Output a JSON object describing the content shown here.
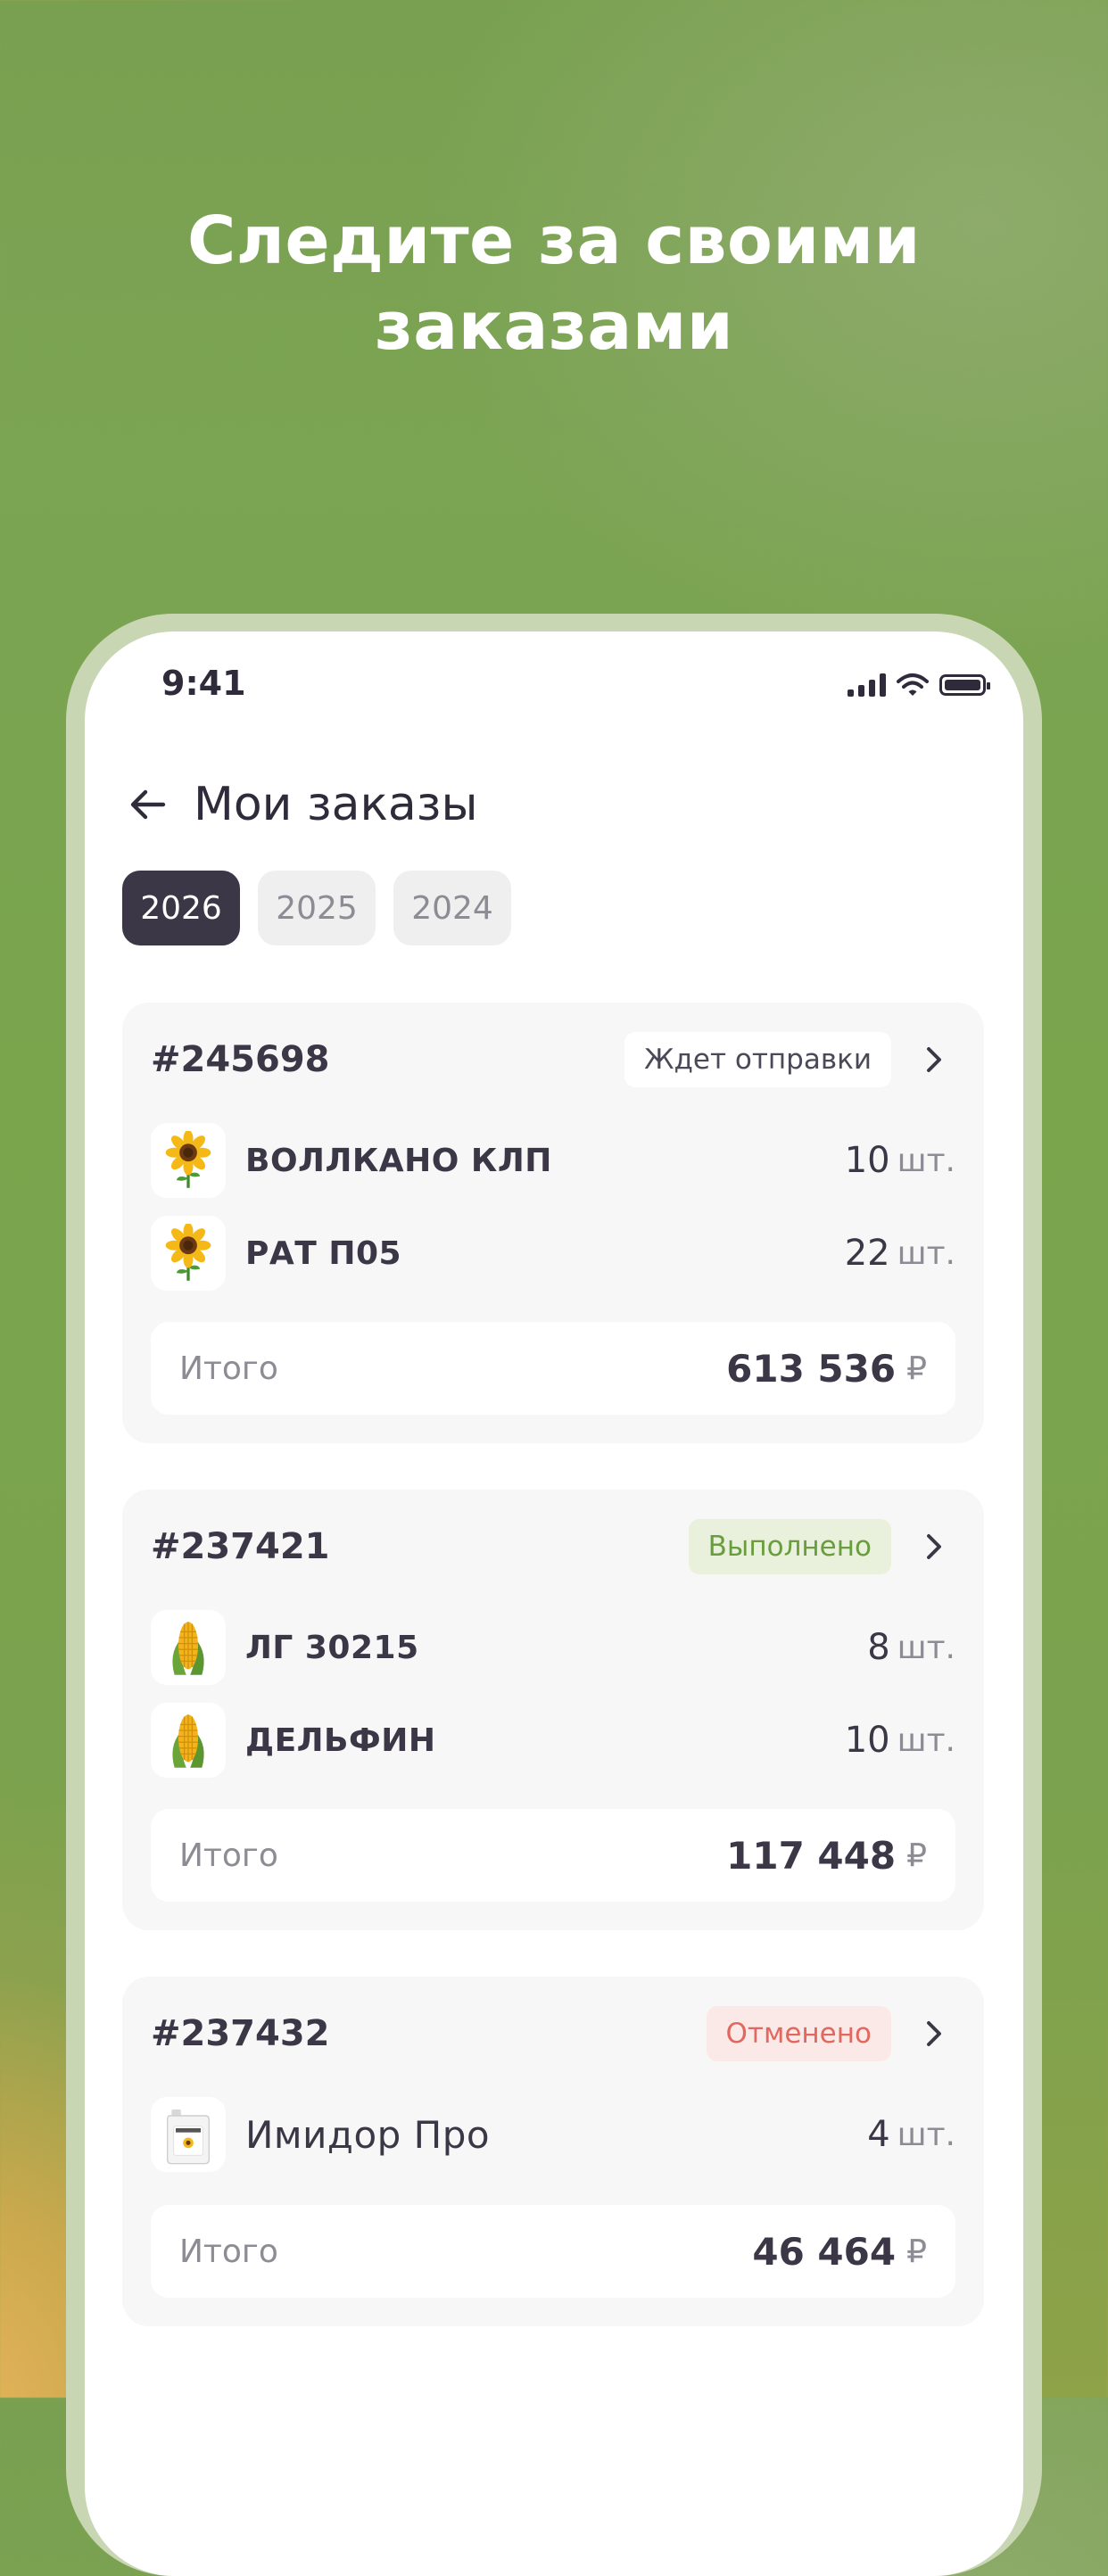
{
  "headline": {
    "line1": "Следите за своими",
    "line2": "заказами"
  },
  "status_bar": {
    "time": "9:41",
    "icons": [
      "signal-icon",
      "wifi-icon",
      "battery-icon"
    ]
  },
  "header": {
    "back_icon": "arrow-left-icon",
    "title": "Мои заказы"
  },
  "years": [
    {
      "label": "2026",
      "selected": true
    },
    {
      "label": "2025",
      "selected": false
    },
    {
      "label": "2024",
      "selected": false
    }
  ],
  "orders": [
    {
      "id": "#245698",
      "status": "Ждет отправки",
      "items": [
        {
          "icon": "sunflower-icon",
          "name": "ВОЛЛКАНО КЛП",
          "qty": "10",
          "unit": "шт."
        },
        {
          "icon": "sunflower-icon",
          "name": "РАТ П05",
          "qty": "22",
          "unit": "шт."
        }
      ],
      "total_label": "Итого",
      "total_value": "613 536",
      "currency": "₽"
    },
    {
      "id": "#237421",
      "status": "Выполнено",
      "items": [
        {
          "icon": "corn-icon",
          "name": "ЛГ 30215",
          "qty": "8",
          "unit": "шт."
        },
        {
          "icon": "corn-icon",
          "name": "ДЕЛЬФИН",
          "qty": "10",
          "unit": "шт."
        }
      ],
      "total_label": "Итого",
      "total_value": "117 448",
      "currency": "₽"
    },
    {
      "id": "#237432",
      "status": "Отменено",
      "items": [
        {
          "icon": "canister-icon",
          "name": "Имидор Про",
          "qty": "4",
          "unit": "шт."
        }
      ],
      "total_label": "Итого",
      "total_value": "46 464",
      "currency": "₽"
    }
  ],
  "colors": {
    "background": "#7ba453",
    "accent_dark": "#3b3746",
    "status_done": "#6a9d3f",
    "status_cancel": "#e1685f",
    "card_bg": "#f7f7f7"
  }
}
